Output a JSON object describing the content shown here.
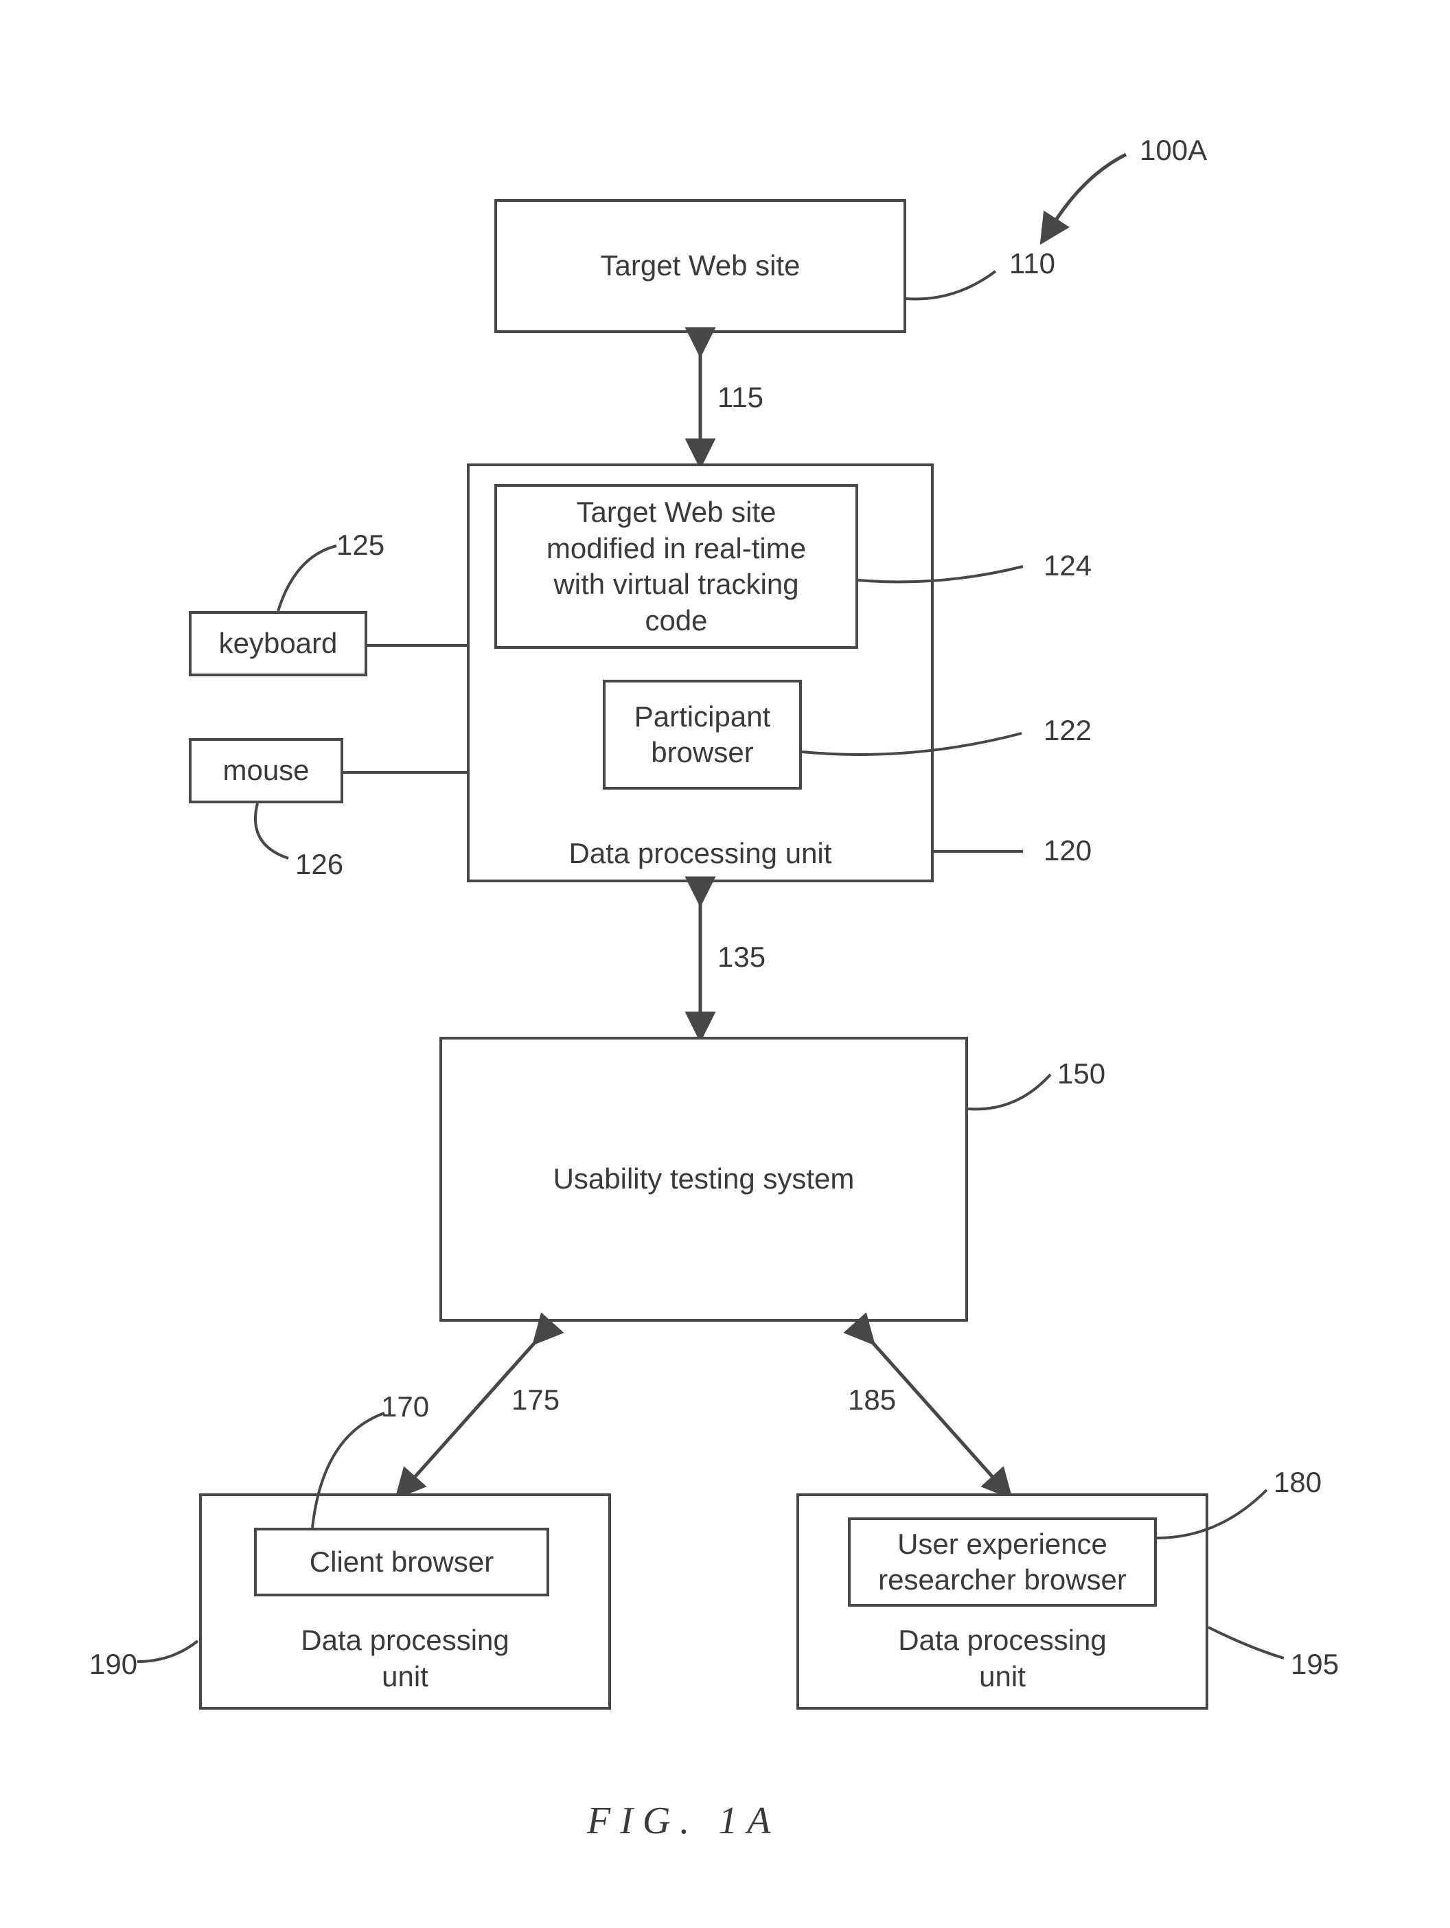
{
  "figure": {
    "caption": "FIG. 1A",
    "overall_ref": "100A"
  },
  "boxes": {
    "target_site": {
      "text": "Target Web site",
      "ref": "110"
    },
    "dpu_participant": {
      "bottom_text": "Data processing unit",
      "ref": "120",
      "inner_tracking": {
        "text": "Target Web site\nmodified in real-time\nwith virtual tracking\ncode",
        "ref": "124"
      },
      "inner_browser": {
        "text": "Participant\nbrowser",
        "ref": "122"
      }
    },
    "keyboard": {
      "text": "keyboard",
      "ref": "125"
    },
    "mouse": {
      "text": "mouse",
      "ref": "126"
    },
    "usability": {
      "text": "Usability testing system",
      "ref": "150"
    },
    "dpu_client": {
      "bottom_text": "Data processing\nunit",
      "ref": "190",
      "inner_browser": {
        "text": "Client browser",
        "ref": "170"
      }
    },
    "dpu_ux": {
      "bottom_text": "Data processing\nunit",
      "ref": "195",
      "inner_browser": {
        "text": "User experience\nresearcher browser",
        "ref": "180"
      }
    }
  },
  "connectors": {
    "c115": "115",
    "c135": "135",
    "c175": "175",
    "c185": "185"
  }
}
